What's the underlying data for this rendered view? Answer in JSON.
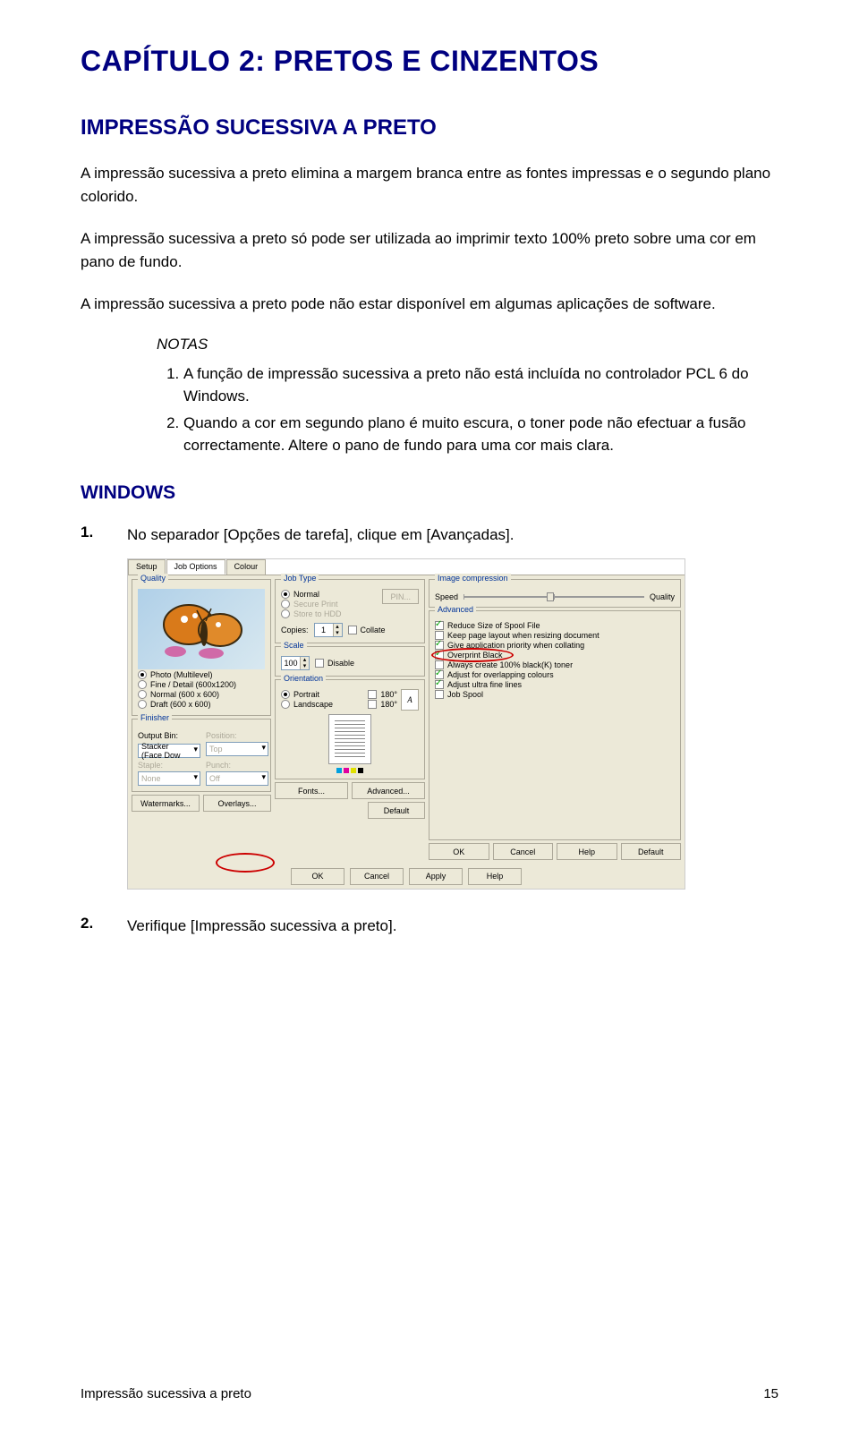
{
  "chapter_title": "CAPÍTULO 2: PRETOS E CINZENTOS",
  "section_title": "IMPRESSÃO SUCESSIVA A PRETO",
  "para1": "A impressão sucessiva a preto elimina a margem branca entre as fontes impressas e o segundo plano colorido.",
  "para2": "A impressão sucessiva a preto só pode ser utilizada ao imprimir texto 100% preto sobre uma cor em pano de fundo.",
  "para3": "A impressão sucessiva a preto pode não estar disponível em algumas aplicações de software.",
  "notes_label": "NOTAS",
  "notes": {
    "n1": "A função de impressão sucessiva a preto não está incluída no controlador PCL 6 do Windows.",
    "n2": "Quando a cor em segundo plano é muito escura, o toner pode não efectuar a fusão correctamente. Altere o pano de fundo para uma cor mais clara."
  },
  "sub_section_title": "WINDOWS",
  "step1": {
    "num": "1.",
    "text": "No separador [Opções de tarefa], clique em [Avançadas]."
  },
  "step2": {
    "num": "2.",
    "text": "Verifique [Impressão sucessiva a preto]."
  },
  "footer": {
    "left": "Impressão sucessiva a preto",
    "right": "15"
  },
  "ss": {
    "tabs": {
      "setup": "Setup",
      "job": "Job Options",
      "colour": "Colour"
    },
    "quality": {
      "title": "Quality",
      "photo": "Photo (Multilevel)",
      "fine": "Fine / Detail (600x1200)",
      "normal": "Normal (600 x 600)",
      "draft": "Draft (600 x 600)"
    },
    "finisher": {
      "title": "Finisher",
      "output_bin_lbl": "Output Bin:",
      "output_bin_val": "Stacker (Face Dow",
      "position_lbl": "Position:",
      "position_val": "Top",
      "staple_lbl": "Staple:",
      "staple_val": "None",
      "punch_lbl": "Punch:",
      "punch_val": "Off"
    },
    "wm_btn": "Watermarks...",
    "ov_btn": "Overlays...",
    "jobtype": {
      "title": "Job Type",
      "normal": "Normal",
      "secure": "Secure Print",
      "store": "Store to HDD",
      "pin_lbl": "PIN...",
      "copies_lbl": "Copies:",
      "copies_val": "1",
      "collate": "Collate"
    },
    "scale": {
      "title": "Scale",
      "val": "100",
      "disable": "Disable"
    },
    "orient": {
      "title": "Orientation",
      "portrait": "Portrait",
      "landscape": "Landscape",
      "r180a": "180°",
      "r180b": "180°",
      "a_label": "A"
    },
    "fonts_btn": "Fonts...",
    "adv_btn": "Advanced...",
    "def_btn": "Default",
    "compression": {
      "title": "Image compression",
      "speed": "Speed",
      "quality": "Quality"
    },
    "advanced": {
      "title": "Advanced",
      "reduce": "Reduce Size of Spool File",
      "keep": "Keep page layout when resizing document",
      "priority": "Give application priority when collating",
      "overprint": "Overprint Black",
      "always100": "Always create 100% black(K) toner",
      "overlap": "Adjust for overlapping colours",
      "ultrafine": "Adjust ultra fine lines",
      "jobspool": "Job Spool"
    },
    "dlg_btns": {
      "ok": "OK",
      "cancel": "Cancel",
      "help": "Help",
      "default": "Default",
      "apply": "Apply"
    }
  }
}
